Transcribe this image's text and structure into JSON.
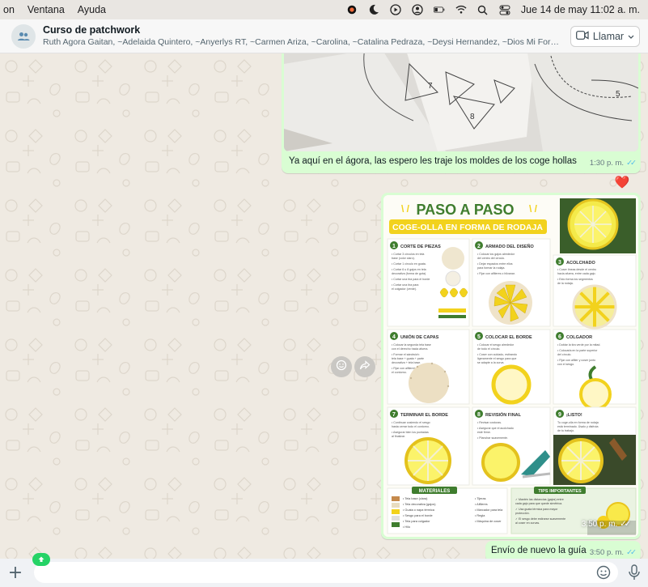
{
  "menubar": {
    "items": [
      "on",
      "Ventana",
      "Ayuda"
    ],
    "datetime": "Jue 14 de may  11:02 a. m."
  },
  "header": {
    "group_name": "Curso de patchwork",
    "members": "Ruth Agora Gaitan, ~Adelaida Quintero, ~Anyerlys RT, ~Carmen Ariza, ~Carolina, ~Catalina Pedraza, ~Deysi Hernandez, ~Dios Mi Fortaleza 🥰...",
    "call_label": "Llamar"
  },
  "messages": [
    {
      "type": "image",
      "caption": "Ya aquí en el ágora, las espero les traje los moldes de los coge hollas",
      "time": "1:30 p. m.",
      "reaction": "❤️"
    },
    {
      "type": "image",
      "time": "3:50 p. m.",
      "infographic": {
        "title": "PASO A PASO",
        "subtitle": "COGE-OLLA EN FORMA DE RODAJA",
        "steps": [
          {
            "num": "1",
            "title": "CORTE DE PIEZAS",
            "lines": [
              "Cortar 3 círculos en tela",
              "base (color claro).",
              "Cortar 1 círculo en guata.",
              "Cortar 6 u 8 gajos en tela",
              "decorativa (forma de gota).",
              "Cortar una tira para el borde",
              "(sesgo).",
              "Cortar una tira para",
              "el colgador (verde)."
            ]
          },
          {
            "num": "2",
            "title": "ARMADO DEL DISEÑO",
            "lines": [
              "Colocar los gajos alrededor",
              "del centro del círculo.",
              "Dejar espacios entre ellos",
              "para formar la rodaja.",
              "Fijar con alfileres o hilvanar."
            ]
          },
          {
            "num": "3",
            "title": "ACOLCHADO",
            "lines": [
              "Coser líneas desde el centro",
              "hacia afuera, entre cada gajo.",
              "Esto forma los segmentos",
              "de la rodaja."
            ]
          },
          {
            "num": "4",
            "title": "UNIÓN DE CAPAS",
            "lines": [
              "Colocar la segunda tela base",
              "con el derecho hacia afuera.",
              "Formar el sándwich:",
              "tela base + guata + parte",
              "decorativa + tela base.",
              "Fijar con alfileres en todo",
              "el contorno."
            ]
          },
          {
            "num": "5",
            "title": "COLOCAR EL BORDE",
            "lines": [
              "Colocar el sesgo alrededor",
              "de todo el círculo.",
              "Coser con cuidado, estirando",
              "ligeramente el sesgo para que",
              "se adapte a la curva."
            ]
          },
          {
            "num": "6",
            "title": "COLGADOR",
            "lines": [
              "Doblar la tira verde por la mitad.",
              "Colocarla en la parte superior",
              "del círculo.",
              "Fijar con alfiler y coser junto",
              "con el sesgo."
            ]
          },
          {
            "num": "7",
            "title": "TERMINAR EL BORDE",
            "lines": [
              "Continuar cosiendo el sesgo",
              "hasta cerrar todo el contorno.",
              "Asegurar bien los puntadas",
              "al finalizar."
            ]
          },
          {
            "num": "8",
            "title": "REVISIÓN FINAL",
            "lines": [
              "Revisar costuras.",
              "Asegurar que el acolchado",
              "esté firme.",
              "Planchar suavemente."
            ]
          },
          {
            "num": "9",
            "title": "¡LISTO!",
            "lines": [
              "Tu coge-olla en forma de rodaja",
              "está terminado. Úsalo y disfruta",
              "de tu trabajo."
            ]
          }
        ],
        "materials_title": "MATERIALES",
        "materials": [
          "Tela base (clara)",
          "Tela decorativa (gajos)",
          "Guata o napa térmica",
          "Sesgo para el borde",
          "Tela para colgador",
          "Hilo"
        ],
        "tools": [
          "Tijeras",
          "Alfileres",
          "Marcador para tela",
          "Regla",
          "Máquina de coser"
        ],
        "tips_title": "TIPS IMPORTANTES",
        "tips": [
          "Mantén las distancias (gajos) entre cada gajo para que quede simétrica.",
          "Usa guata térmica para mayor protección.",
          "El sesgo debe estirarse suavemente al coser en curvas."
        ]
      }
    },
    {
      "type": "text",
      "text": "Envío de nuevo la guía",
      "time": "3:50 p. m."
    }
  ],
  "colors": {
    "outgoing_bubble": "#d9fdd3",
    "chat_bg": "#efeae2",
    "read_ticks": "#53bdeb",
    "accent_green": "#25d366",
    "infographic_yellow": "#f2d21d",
    "infographic_green": "#3f7d2e"
  },
  "icons": [
    "apple-menu",
    "group-avatar-icon",
    "video-call-icon",
    "chevron-down-icon",
    "emoji-icon",
    "forward-icon",
    "plus-icon",
    "sticker-icon",
    "mic-icon",
    "scroll-down-icon"
  ]
}
